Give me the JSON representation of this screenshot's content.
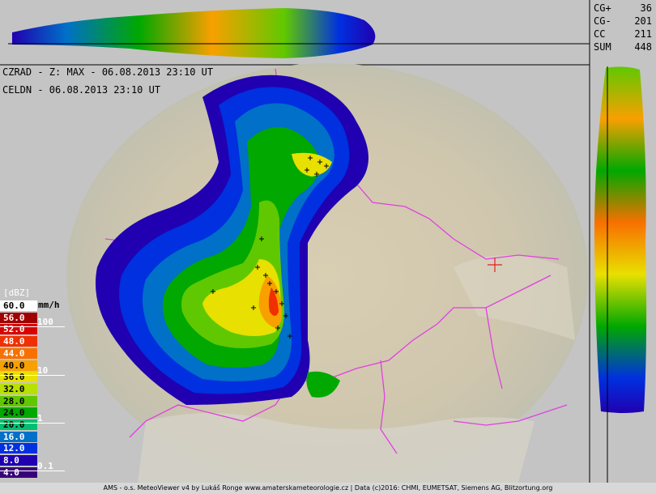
{
  "header": {
    "radar_line": "CZRAD - Z: MAX - 06.08.2013 23:10 UT",
    "lightning_line": "CELDN - 06.08.2013 23:10 UT"
  },
  "lightning_stats": [
    {
      "label": "CG+",
      "value": "36"
    },
    {
      "label": "CG-",
      "value": "201"
    },
    {
      "label": "CC",
      "value": "211"
    },
    {
      "label": "SUM",
      "value": "448"
    }
  ],
  "legend": {
    "unit_label": "[dBZ]",
    "rate_unit": "mm/h",
    "levels": [
      {
        "value": "60.0",
        "color": "#ffffff",
        "text_color": "#000000"
      },
      {
        "value": "56.0",
        "color": "#a00000",
        "text_color": "#ffffff"
      },
      {
        "value": "52.0",
        "color": "#d80000",
        "text_color": "#ffffff"
      },
      {
        "value": "48.0",
        "color": "#f03000",
        "text_color": "#ffffff"
      },
      {
        "value": "44.0",
        "color": "#f87000",
        "text_color": "#ffffff"
      },
      {
        "value": "40.0",
        "color": "#f8a000",
        "text_color": "#000000"
      },
      {
        "value": "36.0",
        "color": "#e8e000",
        "text_color": "#000000"
      },
      {
        "value": "32.0",
        "color": "#b8e000",
        "text_color": "#000000"
      },
      {
        "value": "28.0",
        "color": "#60c800",
        "text_color": "#000000"
      },
      {
        "value": "24.0",
        "color": "#00a800",
        "text_color": "#000000"
      },
      {
        "value": "20.0",
        "color": "#00c070",
        "text_color": "#000000"
      },
      {
        "value": "16.0",
        "color": "#0070c8",
        "text_color": "#ffffff"
      },
      {
        "value": "12.0",
        "color": "#0030e0",
        "text_color": "#ffffff"
      },
      {
        "value": "8.0",
        "color": "#2000b0",
        "text_color": "#ffffff"
      },
      {
        "value": "4.0",
        "color": "#38007a",
        "text_color": "#ffffff"
      }
    ],
    "rates": [
      "100",
      "10",
      "1",
      "0.1"
    ]
  },
  "colors": {
    "border": "#e040e0",
    "background": "#c4c4c4",
    "terrain": "#cfc8b2"
  },
  "footer": "AMS - o.s. MeteoViewer v4 by Lukáš Ronge www.amaterskameteorologie.cz | Data (c)2016: CHMI, EUMETSAT, Siemens AG, Blitzortung.org"
}
